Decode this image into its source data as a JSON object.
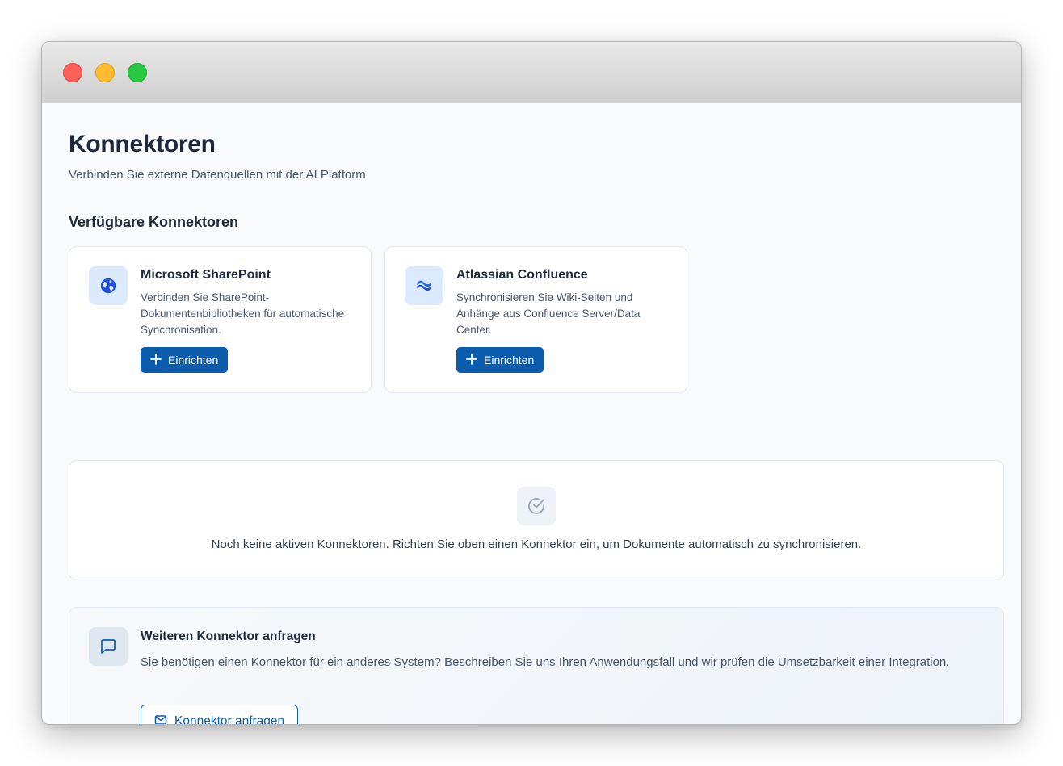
{
  "page": {
    "title": "Konnektoren",
    "subtitle": "Verbinden Sie externe Datenquellen mit der AI Platform"
  },
  "available": {
    "section_title": "Verfügbare Konnektoren",
    "connectors": [
      {
        "icon": "globe-icon",
        "title": "Microsoft SharePoint",
        "description": "Verbinden Sie SharePoint-Dokumentenbibliotheken für automatische Synchronisation.",
        "button_label": "Einrichten"
      },
      {
        "icon": "confluence-icon",
        "title": "Atlassian Confluence",
        "description": "Synchronisieren Sie Wiki-Seiten und Anhänge aus Confluence Server/Data Center.",
        "button_label": "Einrichten"
      }
    ]
  },
  "active": {
    "empty_icon": "check-circle-icon",
    "empty_text": "Noch keine aktiven Konnektoren. Richten Sie oben einen Konnektor ein, um Dokumente automatisch zu synchronisieren."
  },
  "request": {
    "icon": "message-icon",
    "title": "Weiteren Konnektor anfragen",
    "description": "Sie benötigen einen Konnektor für ein anderes System? Beschreiben Sie uns Ihren Anwendungsfall und wir prüfen die Umsetzbarkeit einer Integration.",
    "button_icon": "mail-icon",
    "button_label": "Konnektor anfragen"
  },
  "colors": {
    "primary": "#0b5cad",
    "icon_blue": "#1d4ed8",
    "window_bg": "#f8fafc"
  }
}
